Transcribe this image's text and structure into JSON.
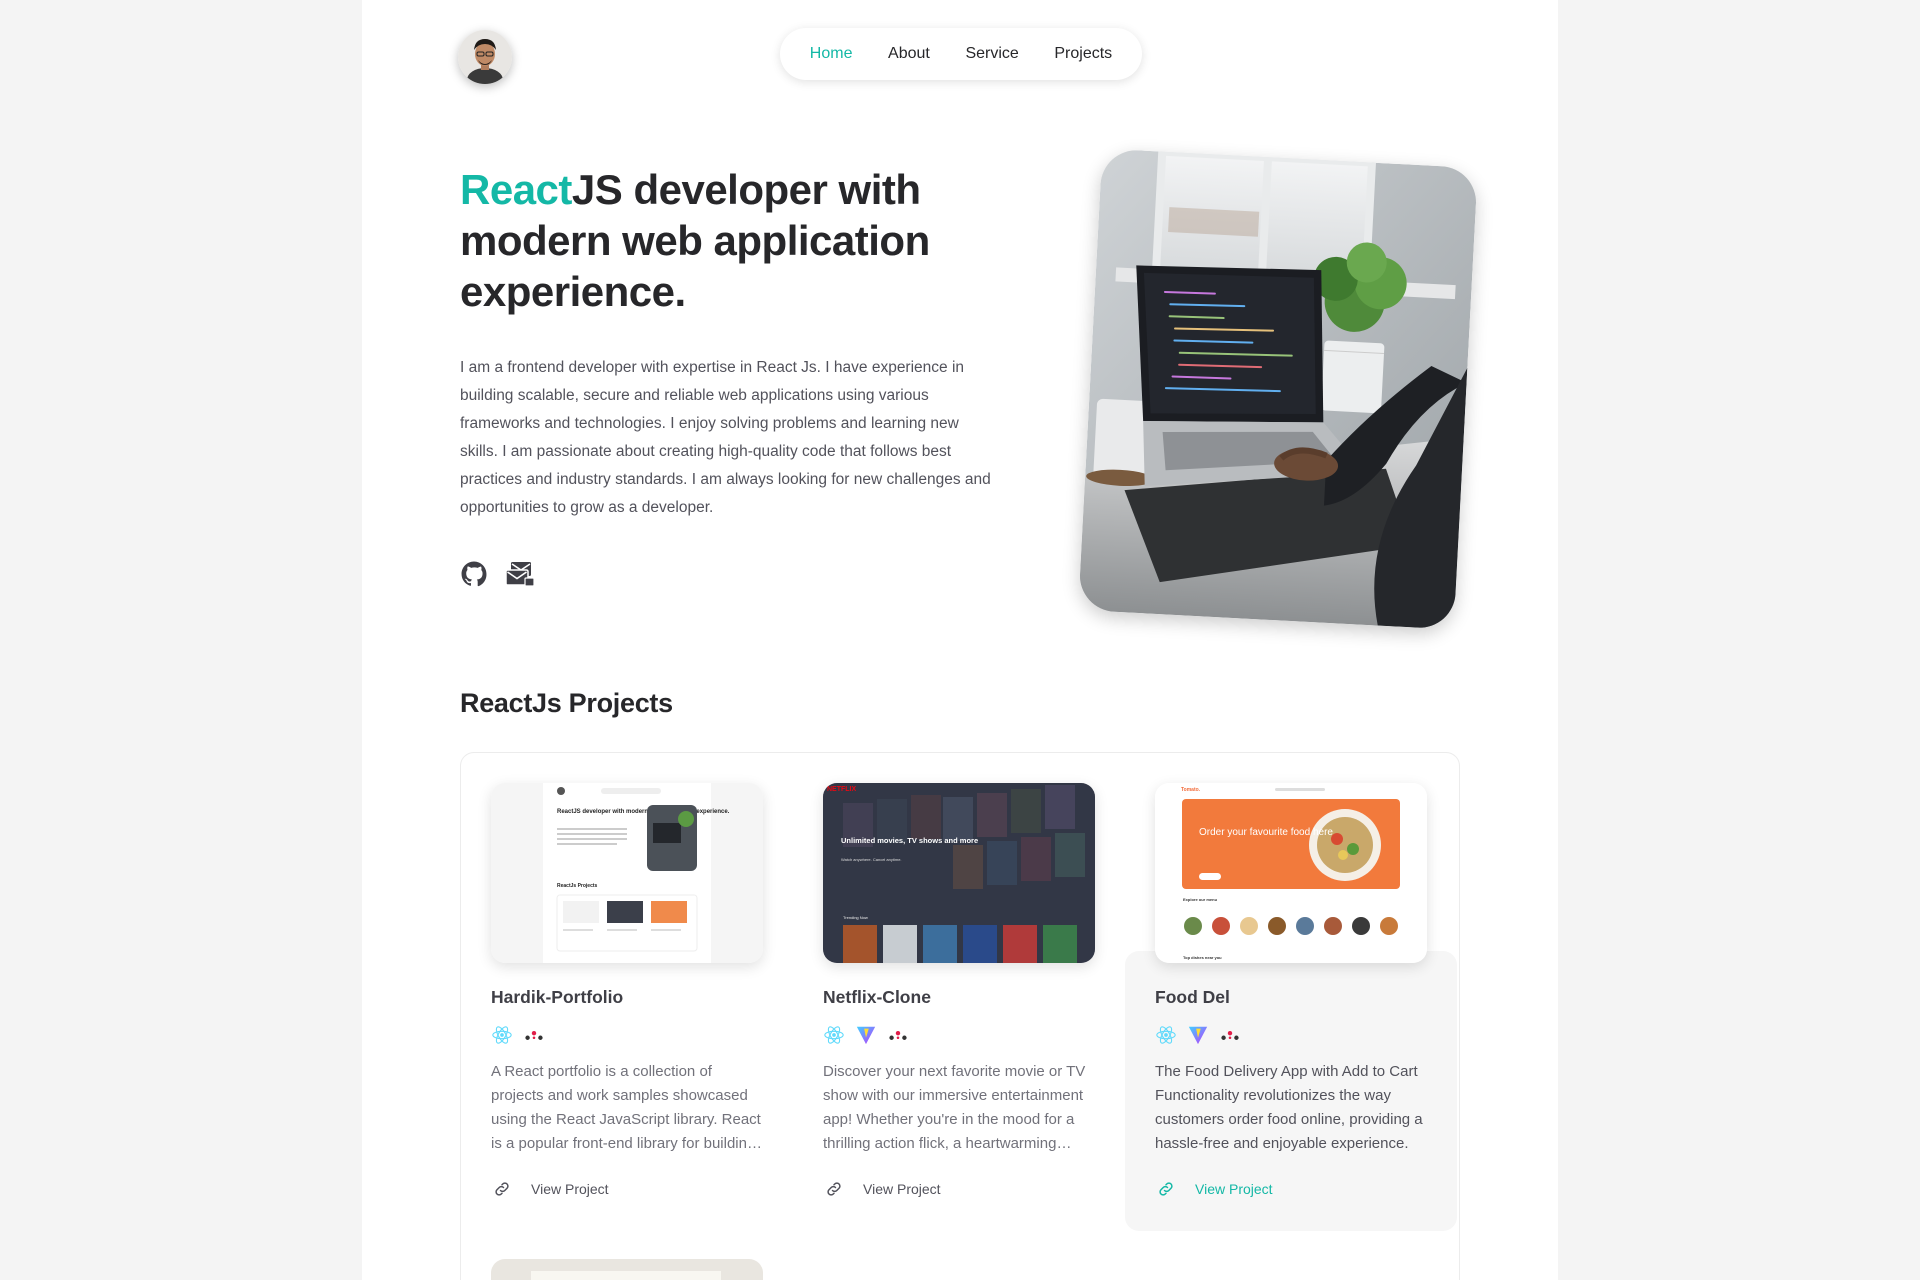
{
  "nav": {
    "items": [
      {
        "label": "Home",
        "active": true
      },
      {
        "label": "About",
        "active": false
      },
      {
        "label": "Service",
        "active": false
      },
      {
        "label": "Projects",
        "active": false
      }
    ]
  },
  "hero": {
    "title_accent": "React",
    "title_rest": "JS developer with modern web application experience.",
    "description": "I am a frontend developer with expertise in React Js. I have experience in building scalable, secure and reliable web applications using various frameworks and technologies. I enjoy solving problems and learning new skills. I am passionate about creating high-quality code that follows best practices and industry standards. I am always looking for new challenges and opportunities to grow as a developer.",
    "social_icons": [
      "github-icon",
      "mail-icon"
    ]
  },
  "projects": {
    "section_title": "ReactJs Projects",
    "cards": [
      {
        "title": "Hardik-Portfolio",
        "stack": [
          "react-icon",
          "router-icon"
        ],
        "description": "A React portfolio is a collection of projects and work samples showcased using the React JavaScript library. React is a popular front-end library for building user interfaces.",
        "link_label": "View Project"
      },
      {
        "title": "Netflix-Clone",
        "stack": [
          "react-icon",
          "vite-icon",
          "router-icon"
        ],
        "description": "Discover your next favorite movie or TV show with our immersive entertainment app! Whether you're in the mood for a thrilling action flick, a heartwarming drama or a comedy.",
        "link_label": "View Project"
      },
      {
        "title": "Food Del",
        "stack": [
          "react-icon",
          "vite-icon",
          "router-icon"
        ],
        "description": "The Food Delivery App with Add to Cart Functionality revolutionizes the way customers order food online, providing a hassle-free and enjoyable experience.",
        "link_label": "View Project"
      }
    ],
    "thumbs": {
      "portfolio": {
        "heading": "ReactJS developer with modern web application experience.",
        "section": "ReactJs Projects"
      },
      "netflix": {
        "brand": "NETFLIX",
        "headline": "Unlimited movies, TV shows and more",
        "subline": "Watch anywhere. Cancel anytime.",
        "row_label": "Trending Now"
      },
      "food": {
        "brand": "Tomato.",
        "headline": "Order your favourite food here",
        "menu_label": "Explore our menu",
        "dishes_label": "Top dishes near you"
      }
    }
  },
  "colors": {
    "accent": "#14b8a6",
    "text": "#27272a",
    "muted": "#71717a"
  }
}
